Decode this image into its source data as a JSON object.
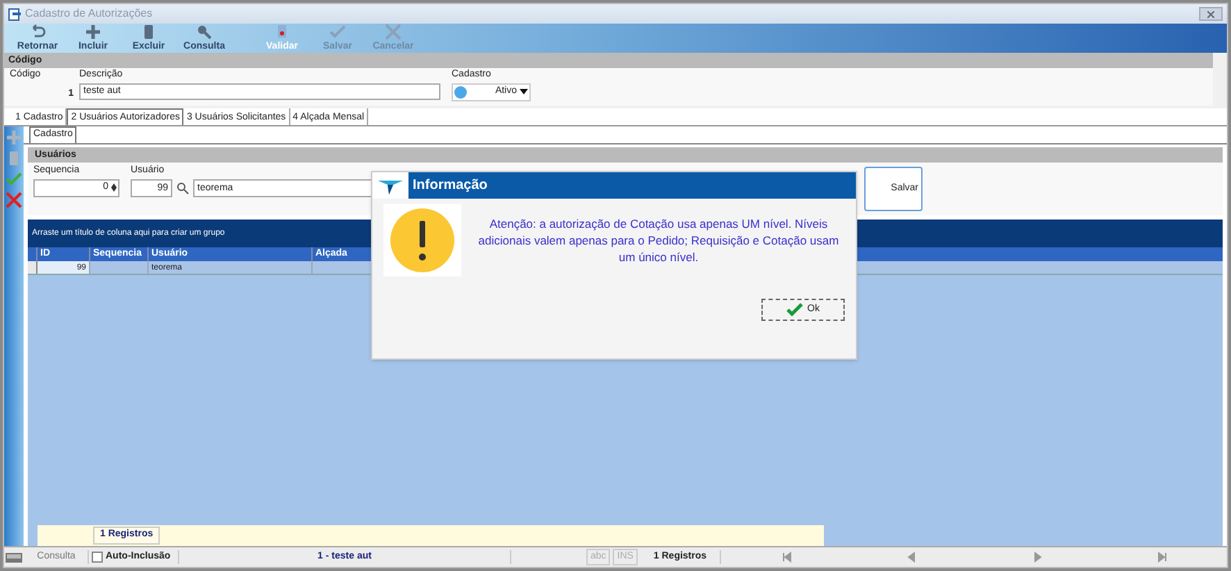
{
  "window": {
    "title": "Cadastro de Autorizações"
  },
  "toolbar": [
    {
      "label": "Retornar",
      "disabled": false,
      "focused": false
    },
    {
      "label": "Incluir",
      "disabled": false,
      "focused": false
    },
    {
      "label": "Excluir",
      "disabled": false,
      "focused": false
    },
    {
      "label": "Consulta",
      "disabled": false,
      "focused": false
    },
    {
      "label": "Validar",
      "disabled": false,
      "focused": true
    },
    {
      "label": "Salvar",
      "disabled": true,
      "focused": false
    },
    {
      "label": "Cancelar",
      "disabled": true,
      "focused": false
    }
  ],
  "header_section": {
    "title": "Código",
    "codigo_label": "Código",
    "codigo_value": "1",
    "descricao_label": "Descrição",
    "descricao_value": "teste aut",
    "cadastro_label": "Cadastro",
    "cadastro_value": "Ativo"
  },
  "tabs": [
    {
      "label": "1 Cadastro",
      "selected": false
    },
    {
      "label": "2 Usuários Autorizadores",
      "selected": true
    },
    {
      "label": "3 Usuários Solicitantes",
      "selected": false
    },
    {
      "label": "4 Alçada Mensal",
      "selected": false
    }
  ],
  "subtab": {
    "label": "Cadastro",
    "selected": true
  },
  "usuarios": {
    "title": "Usuários",
    "sequencia_label": "Sequencia",
    "sequencia_value": "0",
    "usuario_label": "Usuário",
    "usuario_code": "99",
    "usuario_name": "teorema",
    "save_button": "Salvar"
  },
  "grid": {
    "group_hint": "Arraste um título de coluna aqui para criar um grupo",
    "columns": [
      "ID",
      "Sequencia",
      "Usuário",
      "Alçada"
    ],
    "rows": [
      {
        "cells": [
          "99",
          "",
          "teorema",
          ""
        ],
        "selected": true
      }
    ],
    "footer": "1 Registros"
  },
  "status_bar": {
    "mode": "Consulta",
    "auto_inclusao": {
      "label": "Auto-Inclusão",
      "checked": false
    },
    "record": "1 - teste aut",
    "indicators": [
      "abc",
      "INS"
    ],
    "count": "1 Registros"
  },
  "dialog": {
    "title": "Informação",
    "message": "Atenção: a autorização de Cotação usa apenas UM nível. Níveis adicionais valem apenas para o Pedido; Requisição e Cotação usam um único nível.",
    "button": "Ok"
  }
}
